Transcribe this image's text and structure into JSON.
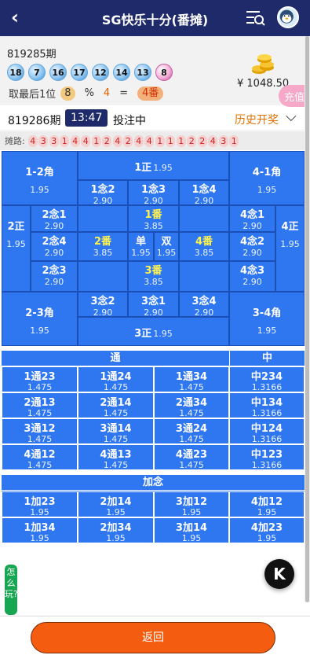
{
  "header": {
    "title": "SG快乐十分(番摊)",
    "back_icon": "‹"
  },
  "last_draw": {
    "issue": "819285期",
    "balls": [
      "18",
      "7",
      "16",
      "17",
      "12",
      "14",
      "13",
      "8"
    ],
    "calc": {
      "label": "取最后1位",
      "digit": "8",
      "percent": "%",
      "divisor": "4",
      "equals": "=",
      "result": "4番"
    },
    "balance": "¥ 1048.50"
  },
  "side_float": "充值",
  "current": {
    "issue": "819286期",
    "timer": "13:47",
    "status": "投注中",
    "history": "历史开奖"
  },
  "road": {
    "label": "摊路:",
    "items": [
      "4",
      "3",
      "3",
      "1",
      "4",
      "4",
      "1",
      "2",
      "4",
      "2",
      "4",
      "4",
      "1",
      "1",
      "1",
      "2",
      "2",
      "4",
      "3",
      "1"
    ]
  },
  "board": {
    "c12j": {
      "label": "1-2角",
      "odds": "1.95"
    },
    "z1": {
      "label": "1正",
      "odds": "1.95"
    },
    "c41j": {
      "label": "4-1角",
      "odds": "1.95"
    },
    "n1_2": {
      "label": "1念2",
      "odds": "2.90"
    },
    "n1_3": {
      "label": "1念3",
      "odds": "2.90"
    },
    "n1_4": {
      "label": "1念4",
      "odds": "2.90"
    },
    "z2": {
      "label": "2正",
      "odds": "1.95"
    },
    "n2_1": {
      "label": "2念1",
      "odds": "2.90"
    },
    "f1": {
      "label": "1番",
      "odds": "3.85"
    },
    "n4_1": {
      "label": "4念1",
      "odds": "2.90"
    },
    "z4": {
      "label": "4正",
      "odds": "1.95"
    },
    "n2_4": {
      "label": "2念4",
      "odds": "2.90"
    },
    "f2": {
      "label": "2番",
      "odds": "3.85"
    },
    "dan": {
      "label": "单",
      "odds": "1.95"
    },
    "shuang": {
      "label": "双",
      "odds": "1.95"
    },
    "f4": {
      "label": "4番",
      "odds": "3.85"
    },
    "n4_2": {
      "label": "4念2",
      "odds": "2.90"
    },
    "n2_3": {
      "label": "2念3",
      "odds": "2.90"
    },
    "f3": {
      "label": "3番",
      "odds": "3.85"
    },
    "n4_3": {
      "label": "4念3",
      "odds": "2.90"
    },
    "c23j": {
      "label": "2-3角",
      "odds": "1.95"
    },
    "n3_2": {
      "label": "3念2",
      "odds": "2.90"
    },
    "n3_1": {
      "label": "3念1",
      "odds": "2.90"
    },
    "n3_4": {
      "label": "3念4",
      "odds": "2.90"
    },
    "c34j": {
      "label": "3-4角",
      "odds": "1.95"
    },
    "z3": {
      "label": "3正",
      "odds": "1.95"
    }
  },
  "tong": {
    "head_tong": "通",
    "head_zhong": "中",
    "rows": [
      [
        {
          "label": "1通23",
          "odds": "1.475"
        },
        {
          "label": "1通24",
          "odds": "1.475"
        },
        {
          "label": "1通34",
          "odds": "1.475"
        },
        {
          "label": "中234",
          "odds": "1.3166"
        }
      ],
      [
        {
          "label": "2通13",
          "odds": "1.475"
        },
        {
          "label": "2通14",
          "odds": "1.475"
        },
        {
          "label": "2通34",
          "odds": "1.475"
        },
        {
          "label": "中134",
          "odds": "1.3166"
        }
      ],
      [
        {
          "label": "3通12",
          "odds": "1.475"
        },
        {
          "label": "3通14",
          "odds": "1.475"
        },
        {
          "label": "3通24",
          "odds": "1.475"
        },
        {
          "label": "中124",
          "odds": "1.3166"
        }
      ],
      [
        {
          "label": "4通12",
          "odds": "1.475"
        },
        {
          "label": "4通13",
          "odds": "1.475"
        },
        {
          "label": "4通23",
          "odds": "1.475"
        },
        {
          "label": "中123",
          "odds": "1.3166"
        }
      ]
    ]
  },
  "jianian": {
    "head": "加念",
    "rows": [
      [
        {
          "label": "1加23",
          "odds": "1.95"
        },
        {
          "label": "2加14",
          "odds": "1.95"
        },
        {
          "label": "3加12",
          "odds": "1.95"
        },
        {
          "label": "4加12",
          "odds": "1.95"
        }
      ],
      [
        {
          "label": "1加34",
          "odds": "1.95"
        },
        {
          "label": "2加34",
          "odds": "1.95"
        },
        {
          "label": "3加14",
          "odds": "1.95"
        },
        {
          "label": "4加23",
          "odds": "1.95"
        }
      ]
    ]
  },
  "how_to": "怎么玩?",
  "fab_k": "K",
  "footer": {
    "back_label": "返回"
  }
}
